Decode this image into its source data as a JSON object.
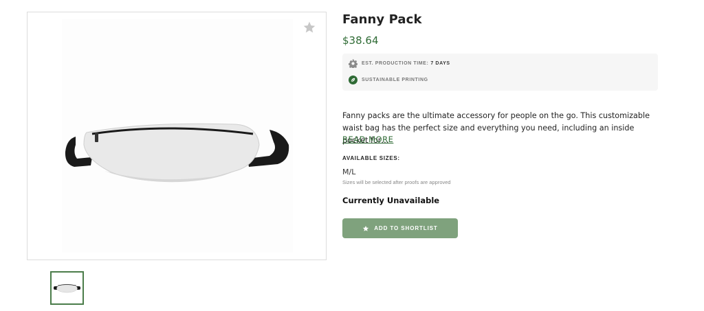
{
  "product": {
    "title": "Fanny Pack",
    "price": "$38.64",
    "production_label": "EST. PRODUCTION TIME:",
    "production_value": "7 DAYS",
    "sustainable_label": "SUSTAINABLE PRINTING",
    "description": "Fanny packs are the ultimate accessory for people on the go. This customizable waist bag has the perfect size and everything you need, including an inside pocket for…",
    "read_more": "READ MORE",
    "sizes_label": "AVAILABLE SIZES:",
    "sizes_value": "M/L",
    "sizes_note": "Sizes will be selected after proofs are approved",
    "availability": "Currently Unavailable",
    "shortlist_button": "ADD TO SHORTLIST"
  },
  "icons": {
    "favorite": "star-icon",
    "production": "gear-icon",
    "sustainable": "leaf-icon",
    "button": "star-icon"
  },
  "colors": {
    "accent": "#2f6b35",
    "button": "#7fa27d",
    "info_bg": "#f6f6f6"
  }
}
